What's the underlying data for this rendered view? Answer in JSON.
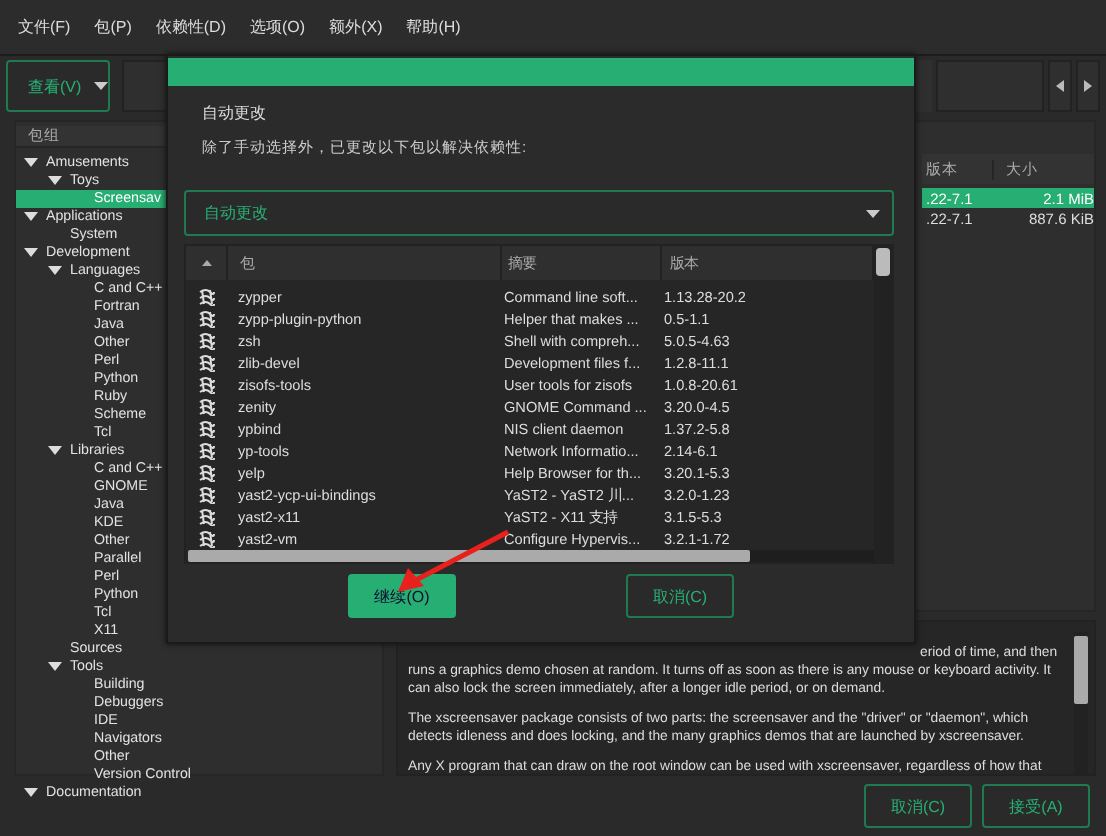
{
  "menu": [
    "文件(F)",
    "包(P)",
    "依赖性(D)",
    "选项(O)",
    "额外(X)",
    "帮助(H)"
  ],
  "toolbar": {
    "view_button": "查看(V)"
  },
  "groups_panel": {
    "header": "包组",
    "tree": [
      {
        "label": "Amusements",
        "expanded": true,
        "selected": false,
        "children": [
          {
            "label": "Toys",
            "expanded": true,
            "selected": false,
            "children": [
              {
                "label": "Screensav",
                "selected": true
              }
            ]
          }
        ]
      },
      {
        "label": "Applications",
        "expanded": true,
        "selected": false,
        "children": [
          {
            "label": "System",
            "selected": false
          }
        ]
      },
      {
        "label": "Development",
        "expanded": true,
        "selected": false,
        "children": [
          {
            "label": "Languages",
            "expanded": true,
            "selected": false,
            "children": [
              {
                "label": "C and C++",
                "selected": false
              },
              {
                "label": "Fortran",
                "selected": false
              },
              {
                "label": "Java",
                "selected": false
              },
              {
                "label": "Other",
                "selected": false
              },
              {
                "label": "Perl",
                "selected": false
              },
              {
                "label": "Python",
                "selected": false
              },
              {
                "label": "Ruby",
                "selected": false
              },
              {
                "label": "Scheme",
                "selected": false
              },
              {
                "label": "Tcl",
                "selected": false
              }
            ]
          },
          {
            "label": "Libraries",
            "expanded": true,
            "selected": false,
            "children": [
              {
                "label": "C and C++",
                "selected": false
              },
              {
                "label": "GNOME",
                "selected": false
              },
              {
                "label": "Java",
                "selected": false
              },
              {
                "label": "KDE",
                "selected": false
              },
              {
                "label": "Other",
                "selected": false
              },
              {
                "label": "Parallel",
                "selected": false
              },
              {
                "label": "Perl",
                "selected": false
              },
              {
                "label": "Python",
                "selected": false
              },
              {
                "label": "Tcl",
                "selected": false
              },
              {
                "label": "X11",
                "selected": false
              }
            ]
          },
          {
            "label": "Sources",
            "selected": false
          },
          {
            "label": "Tools",
            "expanded": true,
            "selected": false,
            "children": [
              {
                "label": "Building",
                "selected": false
              },
              {
                "label": "Debuggers",
                "selected": false
              },
              {
                "label": "IDE",
                "selected": false
              },
              {
                "label": "Navigators",
                "selected": false
              },
              {
                "label": "Other",
                "selected": false
              },
              {
                "label": "Version Control",
                "selected": false
              }
            ]
          }
        ]
      },
      {
        "label": "Documentation",
        "expanded": true,
        "selected": false
      }
    ]
  },
  "packages_table": {
    "columns": [
      "版本",
      "大小"
    ],
    "rows": [
      {
        "cells": [
          ".22-7.1",
          "2.1 MiB"
        ],
        "selected": true
      },
      {
        "cells": [
          ".22-7.1",
          "887.6 KiB"
        ],
        "selected": false
      }
    ]
  },
  "description": [
    "eriod of time, and then runs a graphics demo chosen at random. It turns off as soon as there is any mouse or keyboard activity. It can also lock the screen immediately, after a longer idle period, or on demand.",
    "The xscreensaver package consists of two parts: the screensaver and the \"driver\" or \"daemon\", which detects idleness and does locking, and the many graphics demos that are launched by xscreensaver.",
    "Any X program that can draw on the root window can be used with xscreensaver, regardless of how that"
  ],
  "buttons": [
    {
      "label": "取消(C)",
      "kind": "outline"
    },
    {
      "label": "接受(A)",
      "kind": "outline"
    }
  ],
  "dialog": {
    "heading": "自动更改",
    "message": "除了手动选择外，已更改以下包以解决依赖性:",
    "dropdown": "自动更改",
    "columns": [
      "包",
      "摘要",
      "版本"
    ],
    "rows": [
      {
        "name": "zypper",
        "summary": "Command line soft...",
        "version": "1.13.28-20.2"
      },
      {
        "name": "zypp-plugin-python",
        "summary": "Helper that makes ...",
        "version": "0.5-1.1"
      },
      {
        "name": "zsh",
        "summary": "Shell with compreh...",
        "version": "5.0.5-4.63"
      },
      {
        "name": "zlib-devel",
        "summary": "Development files f...",
        "version": "1.2.8-11.1"
      },
      {
        "name": "zisofs-tools",
        "summary": "User tools for zisofs",
        "version": "1.0.8-20.61"
      },
      {
        "name": "zenity",
        "summary": "GNOME Command ...",
        "version": "3.20.0-4.5"
      },
      {
        "name": "ypbind",
        "summary": "NIS client daemon",
        "version": "1.37.2-5.8"
      },
      {
        "name": "yp-tools",
        "summary": "Network Informatio...",
        "version": "2.14-6.1"
      },
      {
        "name": "yelp",
        "summary": "Help Browser for th...",
        "version": "3.20.1-5.3"
      },
      {
        "name": "yast2-ycp-ui-bindings",
        "summary": "YaST2 - YaST2 川...",
        "version": "3.2.0-1.23"
      },
      {
        "name": "yast2-x11",
        "summary": "YaST2 - X11 支持",
        "version": "3.1.5-5.3"
      },
      {
        "name": "yast2-vm",
        "summary": "Configure Hypervis...",
        "version": "3.2.1-1.72"
      }
    ],
    "buttons": [
      {
        "label": "继续(O)",
        "kind": "primary"
      },
      {
        "label": "取消(C)",
        "kind": "outline"
      }
    ]
  }
}
